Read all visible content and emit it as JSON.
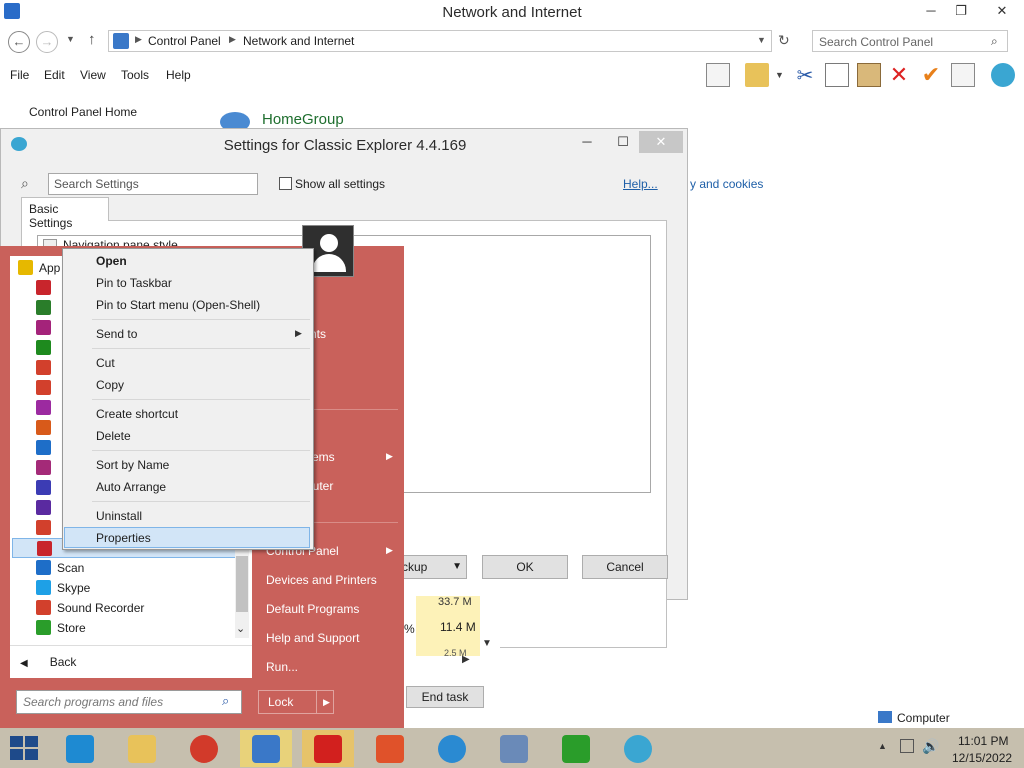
{
  "window": {
    "title": "Network and Internet",
    "minimize": "─",
    "maximize": "❐",
    "close": "✕"
  },
  "address": {
    "breadcrumb": [
      "Control Panel",
      "Network and Internet"
    ],
    "search_placeholder": "Search Control Panel"
  },
  "menubar": [
    "File",
    "Edit",
    "View",
    "Tools",
    "Help"
  ],
  "left_pane": {
    "home": "Control Panel Home"
  },
  "content": {
    "homegroup": "HomeGroup",
    "cookies_link": "y and cookies"
  },
  "dialog": {
    "title": "Settings for Classic Explorer 4.4.169",
    "search_placeholder": "Search Settings",
    "show_all": "Show all settings",
    "help": "Help...",
    "tab": "Basic Settings",
    "setting": "Navigation pane style",
    "backup_partial": "ckup",
    "ok": "OK",
    "cancel": "Cancel"
  },
  "start_menu": {
    "programs": [
      {
        "label": "App",
        "color": "#e6b800"
      },
      {
        "label": "",
        "color": "#c8252c"
      },
      {
        "label": "",
        "color": "#2a7d2a"
      },
      {
        "label": "",
        "color": "#a4237a"
      },
      {
        "label": "",
        "color": "#1e8a1e"
      },
      {
        "label": "",
        "color": "#d2402c"
      },
      {
        "label": "",
        "color": "#d2402c"
      },
      {
        "label": "",
        "color": "#9c2aa0"
      },
      {
        "label": "",
        "color": "#d85a1a"
      },
      {
        "label": "",
        "color": "#1e6ec8"
      },
      {
        "label": "",
        "color": "#a42a78"
      },
      {
        "label": "",
        "color": "#3c3cb4"
      },
      {
        "label": "",
        "color": "#5a2aa0"
      },
      {
        "label": "",
        "color": "#d2402c"
      },
      {
        "label": "",
        "color": "#c8252c"
      },
      {
        "label": "Scan",
        "color": "#1e6ec8"
      },
      {
        "label": "Skype",
        "color": "#1ea0e6"
      },
      {
        "label": "Sound Recorder",
        "color": "#d2402c"
      },
      {
        "label": "Store",
        "color": "#2a9d2a"
      }
    ],
    "back": "Back",
    "search_placeholder": "Search programs and files",
    "right": {
      "items_partial": "nts",
      "recent_partial": "ems",
      "computer_partial": "puter",
      "control_panel": "Control Panel",
      "devices": "Devices and Printers",
      "default_programs": "Default Programs",
      "help": "Help and Support",
      "run": "Run..."
    },
    "lock": "Lock"
  },
  "context_menu": {
    "open": "Open",
    "pin_taskbar": "Pin to Taskbar",
    "pin_start": "Pin to Start menu (Open-Shell)",
    "send_to": "Send to",
    "cut": "Cut",
    "copy": "Copy",
    "create_shortcut": "Create shortcut",
    "delete": "Delete",
    "sort": "Sort by Name",
    "arrange": "Auto Arrange",
    "uninstall": "Uninstall",
    "properties": "Properties"
  },
  "task_manager": {
    "mem1": "33.7 M",
    "pct": "%",
    "mem2": "11.4 M",
    "mem3": "2.5 M",
    "end_task": "End task"
  },
  "status": {
    "computer": "Computer"
  },
  "taskbar": {
    "apps": [
      "ie",
      "file-explorer",
      "chrome",
      "control-panel",
      "opera",
      "brave",
      "network",
      "task-manager",
      "office",
      "classic-shell"
    ],
    "time": "11:01 PM",
    "date": "12/15/2022"
  },
  "colors": {
    "start_menu": "#c9615b",
    "taskbar": "#c6bfae",
    "selection": "#d2e5f7",
    "link": "#1e5fa8"
  }
}
